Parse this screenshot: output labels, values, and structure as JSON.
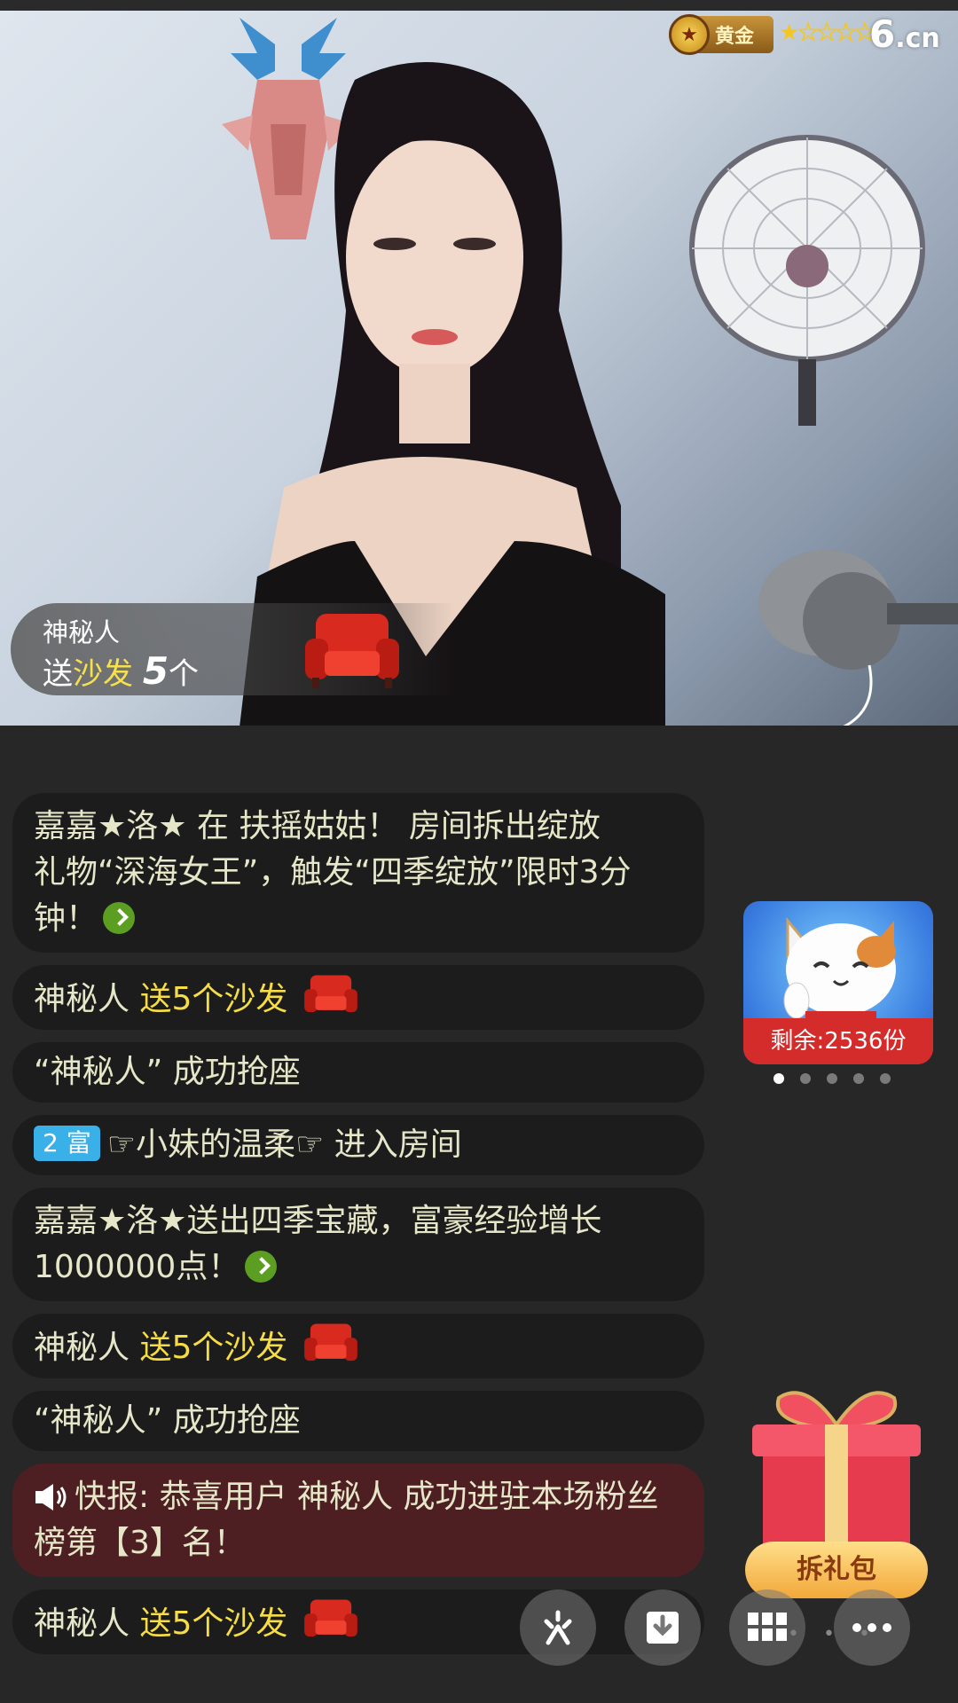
{
  "video": {
    "level_label": "黄金",
    "stars_filled": 1,
    "stars_total": 5,
    "logo_text": "6",
    "logo_suffix": ".cn",
    "gift_banner": {
      "sender": "神秘人",
      "prefix": "送",
      "gift_name": "沙发",
      "count": "5",
      "unit": "个"
    }
  },
  "chat": {
    "messages": [
      {
        "a": "嘉嘉★洛★ 在 扶摇姑姑！ 房间拆出绽放",
        "b": "礼物“深海女王”，触发“四季绽放”限时3分",
        "c": "钟！"
      },
      {
        "sender": "神秘人",
        "action": "送5个沙发"
      },
      {
        "text": "“神秘人” 成功抢座"
      },
      {
        "badge": "2 富",
        "user": "☞小妹的温柔☞",
        "action": "进入房间"
      },
      {
        "a": "嘉嘉★洛★送出四季宝藏，富豪经验增长",
        "b": "1000000点！"
      },
      {
        "sender": "神秘人",
        "action": "送5个沙发"
      },
      {
        "text": "“神秘人” 成功抢座"
      },
      {
        "a": "快报: 恭喜用户 神秘人 成功进驻本场粉丝",
        "b": "榜第【3】名！"
      },
      {
        "sender": "神秘人",
        "action": "送5个沙发"
      }
    ]
  },
  "promo": {
    "remaining": "剩余:2536份",
    "page_count": 5,
    "active_page": 1
  },
  "giftbox": {
    "button_label": "拆礼包"
  },
  "toolbar": {
    "icons": [
      "sparkle-icon",
      "download-icon",
      "grid-icon",
      "more-icon"
    ]
  }
}
